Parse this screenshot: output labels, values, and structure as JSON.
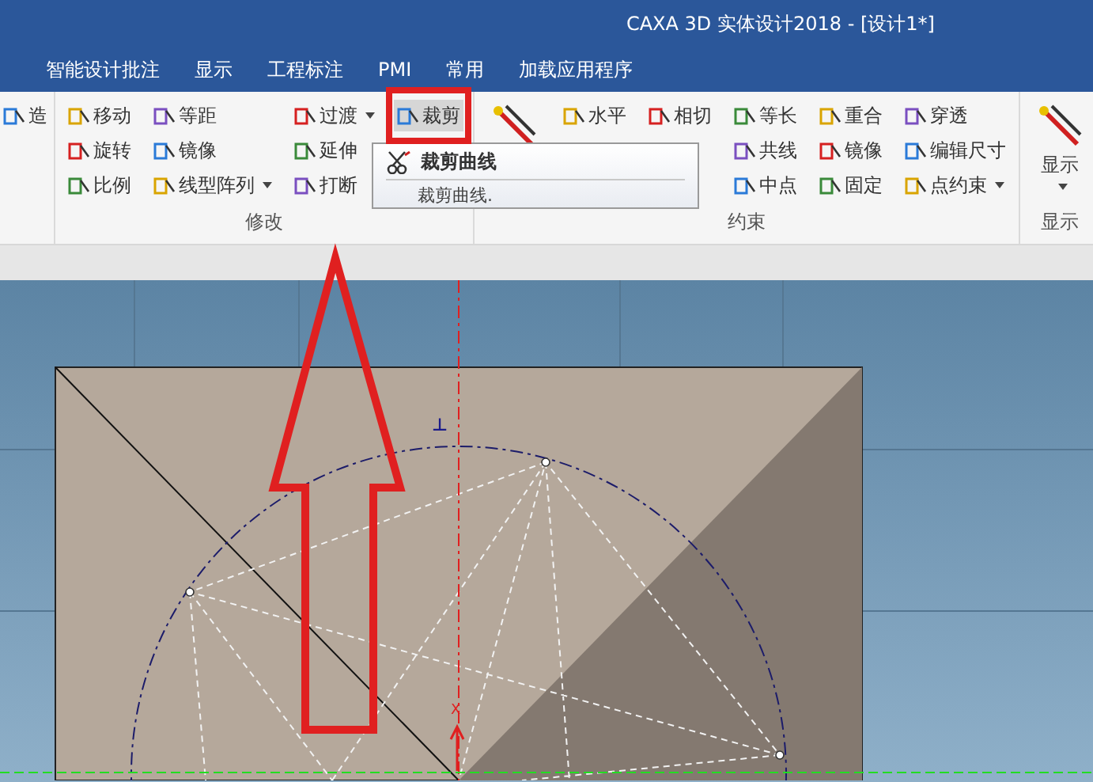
{
  "window": {
    "title": "CAXA 3D 实体设计2018 - [设计1*]"
  },
  "tabs": [
    {
      "label": "智能设计批注",
      "selected": false
    },
    {
      "label": "显示",
      "selected": false
    },
    {
      "label": "工程标注",
      "selected": false
    },
    {
      "label": "PMI",
      "selected": false
    },
    {
      "label": "常用",
      "selected": false
    },
    {
      "label": "加载应用程序",
      "selected": false
    }
  ],
  "ribbon": {
    "groups": [
      {
        "columns": [
          [
            {
              "label": "造",
              "dropdown": false,
              "highlighted": false
            }
          ]
        ]
      },
      {
        "label": "修改",
        "columns": [
          [
            {
              "label": "移动",
              "dropdown": false,
              "highlighted": false
            },
            {
              "label": "旋转",
              "dropdown": false,
              "highlighted": false
            },
            {
              "label": "比例",
              "dropdown": false,
              "highlighted": false
            }
          ],
          [
            {
              "label": "等距",
              "dropdown": false,
              "highlighted": false
            },
            {
              "label": "镜像",
              "dropdown": false,
              "highlighted": false
            },
            {
              "label": "线型阵列",
              "dropdown": true,
              "highlighted": false
            }
          ],
          [
            {
              "label": "过渡",
              "dropdown": true,
              "highlighted": false
            },
            {
              "label": "延伸",
              "dropdown": false,
              "highlighted": false
            },
            {
              "label": "打断",
              "dropdown": false,
              "highlighted": false
            }
          ],
          [
            {
              "label": "裁剪",
              "dropdown": false,
              "highlighted": true
            }
          ]
        ]
      },
      {
        "label": "约束",
        "big_button": {
          "dropdown": false
        },
        "columns": [
          [
            {
              "label": "水平",
              "dropdown": false,
              "highlighted": false
            }
          ],
          [
            {
              "label": "相切",
              "dropdown": false,
              "highlighted": false
            }
          ],
          [
            {
              "label": "等长",
              "dropdown": false,
              "highlighted": false
            },
            {
              "label": "共线",
              "dropdown": false,
              "highlighted": false
            },
            {
              "label": "中点",
              "dropdown": false,
              "highlighted": false
            }
          ],
          [
            {
              "label": "重合",
              "dropdown": false,
              "highlighted": false
            },
            {
              "label": "镜像",
              "dropdown": false,
              "highlighted": false
            },
            {
              "label": "固定",
              "dropdown": false,
              "highlighted": false
            }
          ],
          [
            {
              "label": "穿透",
              "dropdown": false,
              "highlighted": false
            },
            {
              "label": "编辑尺寸",
              "dropdown": false,
              "highlighted": false
            },
            {
              "label": "点约束",
              "dropdown": true,
              "highlighted": false
            }
          ]
        ]
      },
      {
        "label": "显示",
        "big_button": {
          "label": "显示",
          "dropdown": true
        }
      }
    ]
  },
  "tooltip": {
    "title": "裁剪曲线",
    "text": "裁剪曲线."
  },
  "canvas": {
    "labels": [
      {
        "kind": "constraint",
        "text": "⊥"
      },
      {
        "kind": "axis",
        "text": "X"
      }
    ]
  }
}
